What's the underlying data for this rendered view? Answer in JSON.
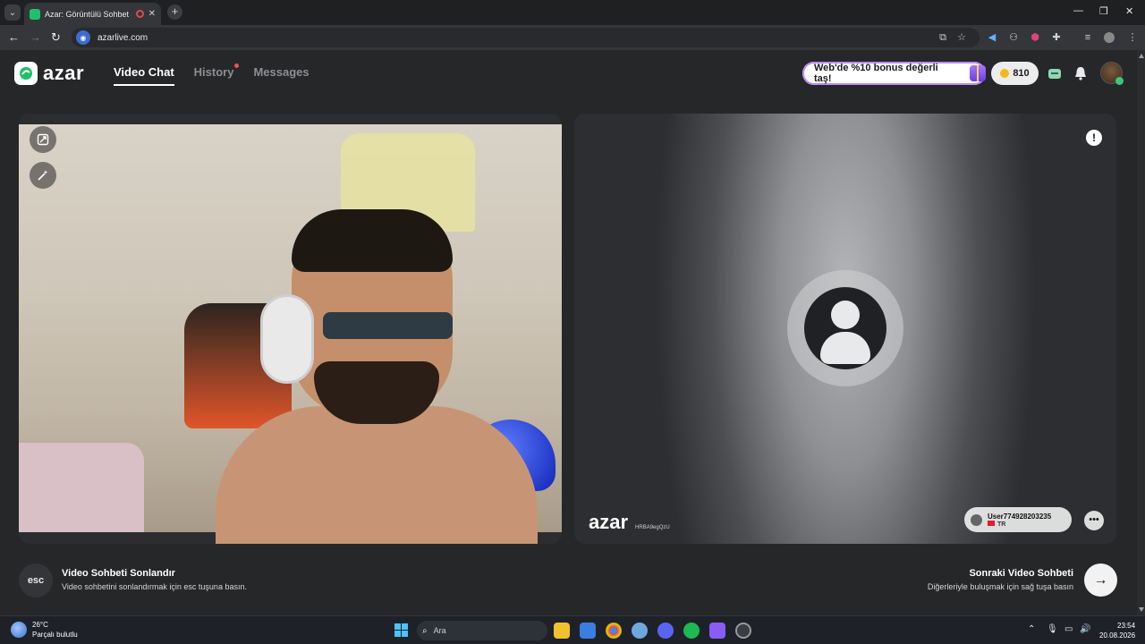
{
  "browser": {
    "tab_title": "Azar: Görüntülü Sohbet & Y",
    "url": "azarlive.com"
  },
  "header": {
    "logo": "azar",
    "nav": [
      {
        "label": "Video Chat",
        "active": true
      },
      {
        "label": "History",
        "badge": true
      },
      {
        "label": "Messages"
      }
    ],
    "promo": "Web'de %10 bonus değerli taş!",
    "coins": "810"
  },
  "video": {
    "watermark": "azar",
    "watermark_id": "HRBA9egQzU",
    "remote_user": "User774928203235",
    "remote_country": "TR"
  },
  "controls": {
    "esc_key": "esc",
    "end_title": "Video Sohbeti Sonlandır",
    "end_sub": "Video sohbetini sonlandırmak için esc tuşuna basın.",
    "next_title": "Sonraki Video Sohbeti",
    "next_sub": "Diğerleriyle buluşmak için sağ tuşa basın"
  },
  "taskbar": {
    "temp": "26°C",
    "weather": "Parçalı bulutlu",
    "search_placeholder": "Ara",
    "time": "23:54",
    "date": "20.08.2026"
  },
  "colors": {
    "accent": "#1ec16b",
    "badge": "#ff4b55"
  }
}
